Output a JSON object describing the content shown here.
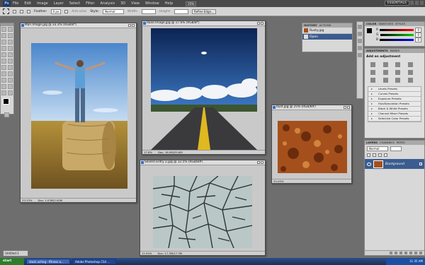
{
  "app": {
    "logo": "Ps",
    "menu": [
      "File",
      "Edit",
      "Image",
      "Layer",
      "Select",
      "Filter",
      "Analysis",
      "3D",
      "View",
      "Window",
      "Help"
    ],
    "zoom_select": "25%",
    "workspace": "ESSENTIALS"
  },
  "options": {
    "feather_label": "Feather:",
    "feather_value": "0 px",
    "antialias": "Anti-alias",
    "style_label": "Style:",
    "style_value": "Normal",
    "width_label": "Width:",
    "height_label": "Height:",
    "refine": "Refine Edge..."
  },
  "docs": {
    "man": {
      "title": "Man Image.jpg @ 33.3% (RGB/8*)",
      "zoom": "33.33%",
      "doc": "Doc: 1.03M/2.00M"
    },
    "road": {
      "title": "Road Image.jpg @ 17.6% (RGB/8*)",
      "zoom": "17.6%",
      "doc": "Doc: 16.9M/25.6M"
    },
    "rust": {
      "title": "Rust.jpg @ 25% (RGB/8#)",
      "zoom": "25.00%",
      "doc": ""
    },
    "cracks": {
      "title": "Severe Entry 2.jpg @ 12.5% (RGB/8#)",
      "zoom": "12.50%",
      "doc": "Doc: 17.3M/17.3M"
    }
  },
  "history": {
    "tabs": [
      "HISTORY",
      "ACTIONS"
    ],
    "items": [
      "Rusty.jpg",
      "Open"
    ]
  },
  "color": {
    "tabs": [
      "COLOR",
      "SWATCHES",
      "STYLES"
    ],
    "channels": [
      "R",
      "G",
      "B"
    ],
    "values": [
      "0",
      "0",
      "0"
    ]
  },
  "adjustments": {
    "tabs": [
      "ADJUSTMENTS",
      "MASKS"
    ],
    "heading": "Add an adjustment",
    "presets": [
      "Levels Presets",
      "Curves Presets",
      "Exposure Presets",
      "Hue/Saturation Presets",
      "Black & White Presets",
      "Channel Mixer Presets",
      "Selective Color Presets"
    ]
  },
  "layers": {
    "tabs": [
      "LAYERS",
      "CHANNELS",
      "PATHS"
    ],
    "blend": "Normal",
    "layer_name": "Background"
  },
  "minimized": {
    "label": "Untitled-1"
  },
  "taskbar": {
    "start": "start",
    "tasks": [
      "stock.xchng - fitness a...",
      "Adobe Photoshop CS4 ..."
    ],
    "clock": "11:35 AM"
  },
  "colors": {
    "accent": "#2f5ea8",
    "rust": "#a5501c",
    "sky": "#1f4f97"
  }
}
